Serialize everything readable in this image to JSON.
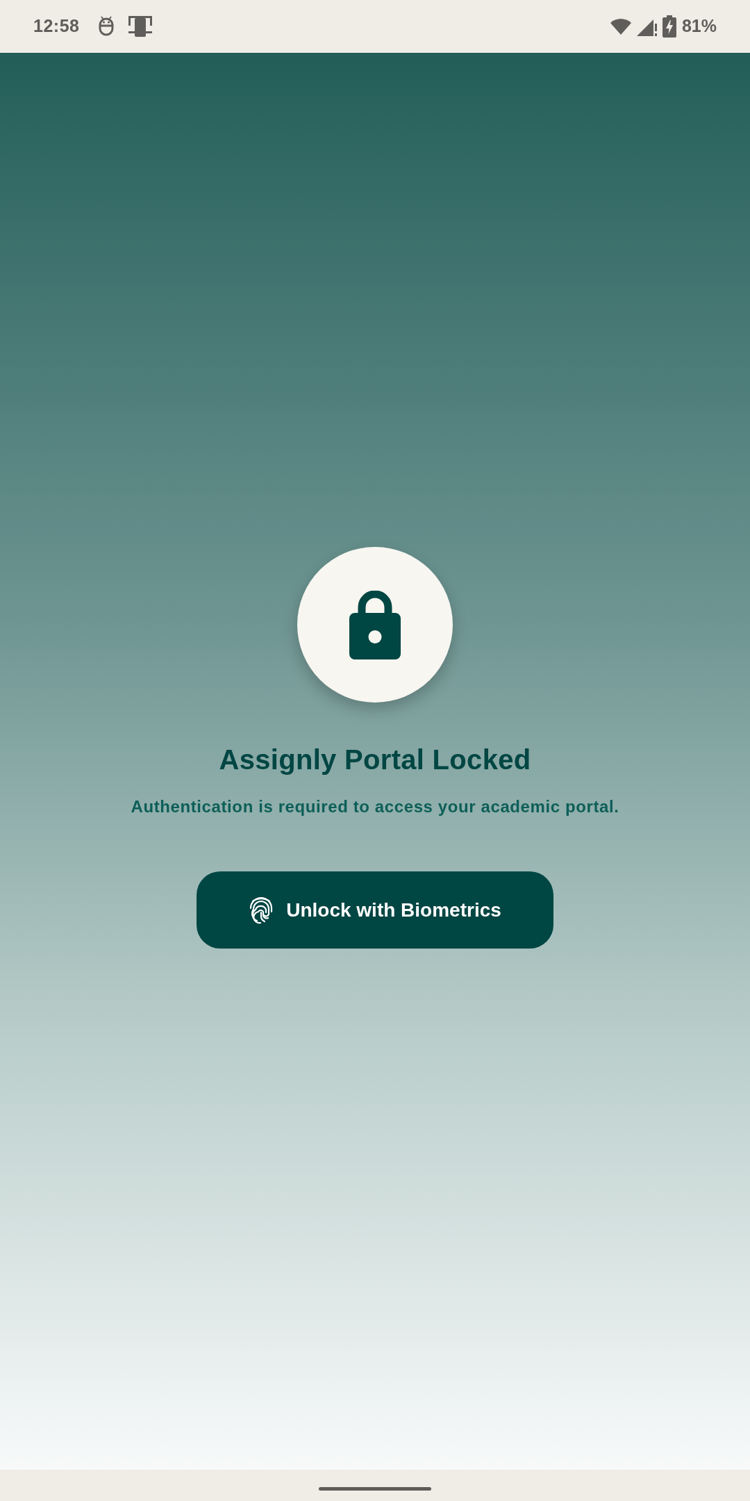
{
  "status_bar": {
    "time": "12:58",
    "battery": "81%"
  },
  "lock_screen": {
    "title": "Assignly Portal Locked",
    "message": "Authentication is required to access your academic portal.",
    "button": {
      "label": "Unlock with Biometrics"
    }
  }
}
